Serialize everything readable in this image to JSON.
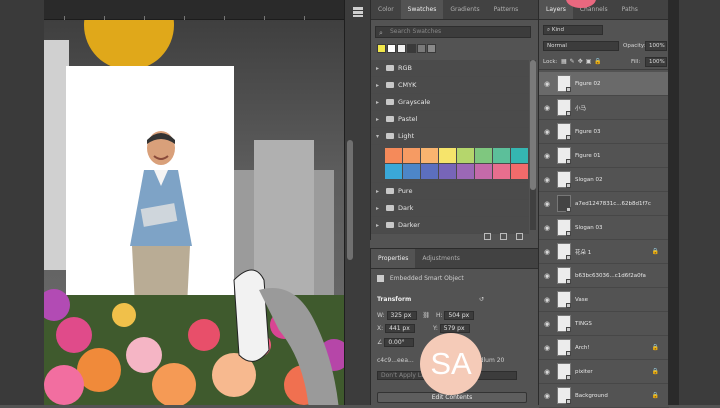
{
  "swatches_panel": {
    "tabs": [
      "Color",
      "Swatches",
      "Gradients",
      "Patterns"
    ],
    "active_tab": "Swatches",
    "search_placeholder": "Search Swatches",
    "recent_colors": [
      "#f2e84a",
      "#ffffff",
      "#f0f0f0",
      "#3a3a3a",
      "#7a7a7a",
      "#8a8a8a"
    ],
    "groups": [
      {
        "name": "RGB",
        "expanded": false
      },
      {
        "name": "CMYK",
        "expanded": false
      },
      {
        "name": "Grayscale",
        "expanded": false
      },
      {
        "name": "Pastel",
        "expanded": false
      },
      {
        "name": "Light",
        "expanded": true
      },
      {
        "name": "Pure",
        "expanded": false
      },
      {
        "name": "Dark",
        "expanded": false
      },
      {
        "name": "Darker",
        "expanded": false
      }
    ],
    "light_swatches": [
      "#f58a5a",
      "#f69b63",
      "#f9b46f",
      "#f6e46b",
      "#b5d66c",
      "#7fc77f",
      "#5cbf9a",
      "#35b6b1",
      "#3aa8d8",
      "#4d86c8",
      "#5c6fbf",
      "#7765b8",
      "#9b68b6",
      "#c46aa9",
      "#e86e8e",
      "#f26b6b"
    ]
  },
  "properties_panel": {
    "tabs": [
      "Properties",
      "Adjustments"
    ],
    "active_tab": "Properties",
    "layer_kind": "Embedded Smart Object",
    "section": "Transform",
    "w_label": "W:",
    "w_value": "325 px",
    "h_label": "H:",
    "h_value": "504 px",
    "x_label": "X:",
    "x_value": "441 px",
    "y_label": "Y:",
    "y_value": "579 px",
    "angle_value": "0.00°",
    "file_row": "c4c9...eea...",
    "file_suffix": "irdlum 20",
    "layer_comp_placeholder": "Don't Apply Layer Comp",
    "edit_contents": "Edit Contents"
  },
  "layers_panel": {
    "tabs": [
      "Layers",
      "Channels",
      "Paths"
    ],
    "active_tab": "Layers",
    "filter_label": "Kind",
    "blend_mode": "Normal",
    "opacity_label": "Opacity:",
    "opacity_value": "100%",
    "lock_label": "Lock:",
    "fill_label": "Fill:",
    "fill_value": "100%",
    "layers": [
      {
        "name": "Figure 02",
        "selected": true,
        "locked": false,
        "dark": false
      },
      {
        "name": "小马",
        "selected": false,
        "locked": false,
        "dark": false
      },
      {
        "name": "Figure 03",
        "selected": false,
        "locked": false,
        "dark": false
      },
      {
        "name": "Figure 01",
        "selected": false,
        "locked": false,
        "dark": false
      },
      {
        "name": "Slogan 02",
        "selected": false,
        "locked": false,
        "dark": false
      },
      {
        "name": "a7ed1247831c...62b8d1f7c",
        "selected": false,
        "locked": false,
        "dark": true
      },
      {
        "name": "Slogan 03",
        "selected": false,
        "locked": false,
        "dark": false
      },
      {
        "name": "花朵 1",
        "selected": false,
        "locked": true,
        "dark": false
      },
      {
        "name": "b63bc63036...c1d6f2a0fa",
        "selected": false,
        "locked": false,
        "dark": false
      },
      {
        "name": "Vase",
        "selected": false,
        "locked": false,
        "dark": false
      },
      {
        "name": "TINGS",
        "selected": false,
        "locked": false,
        "dark": false
      },
      {
        "name": "Arch!",
        "selected": false,
        "locked": true,
        "dark": false
      },
      {
        "name": "pixiter",
        "selected": false,
        "locked": true,
        "dark": false
      },
      {
        "name": "Background",
        "selected": false,
        "locked": true,
        "dark": false
      }
    ]
  },
  "watermark": {
    "text": "SA"
  },
  "colors": {
    "panel_bg": "#535353",
    "canvas_bg": "#262626",
    "selected_layer": "#6a6a6a",
    "watermark": "#f5cbb8"
  }
}
